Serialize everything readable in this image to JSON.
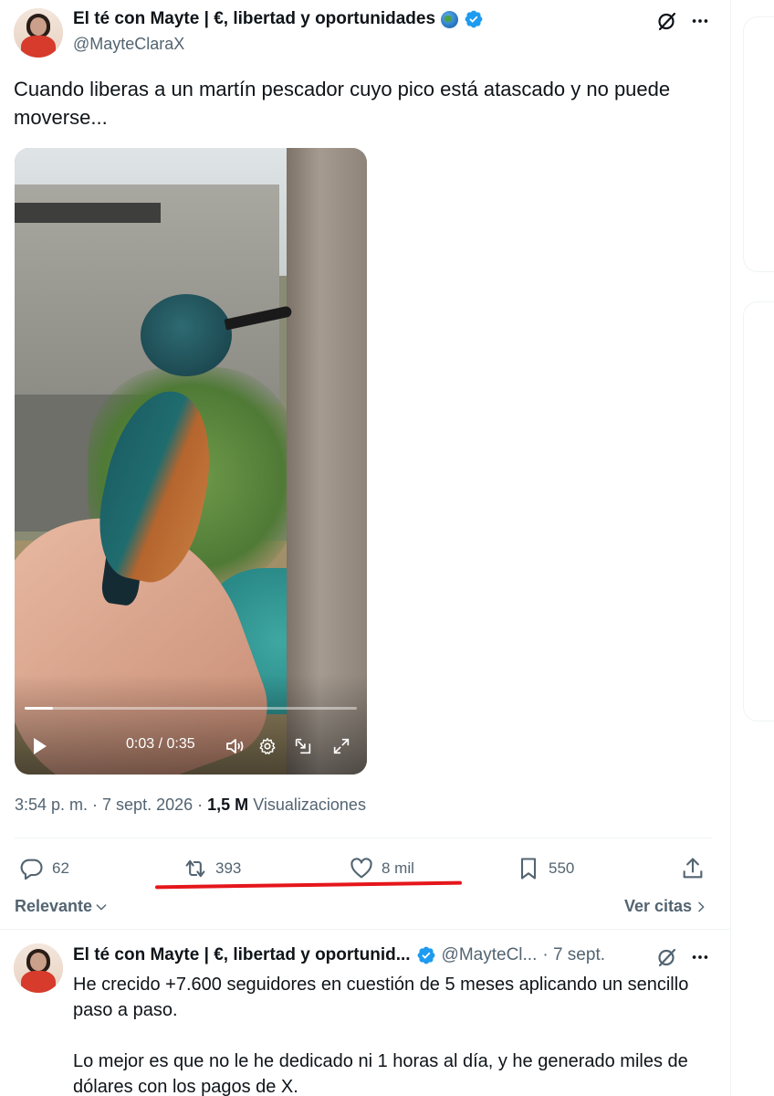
{
  "tweet": {
    "author_name": "El té con Mayte | €, libertad y oportunidades",
    "author_handle": "@MayteClaraX",
    "text": "Cuando liberas a un martín pescador cuyo pico está atascado y no puede moverse...",
    "video": {
      "current_time": "0:03",
      "duration": "0:35",
      "time_label": "0:03 / 0:35",
      "progress_fraction": 0.086
    },
    "timestamp": "3:54 p. m. · 7 sept. 2026",
    "separator": "·",
    "views_count": "1,5 M",
    "views_label": "Visualizaciones",
    "stats": {
      "replies": "62",
      "reposts": "393",
      "likes": "8 mil",
      "bookmarks": "550"
    }
  },
  "replies_section": {
    "sort_label": "Relevante",
    "quotes_link": "Ver citas"
  },
  "reply": {
    "author_name": "El té con Mayte | €, libertad y oportunid...",
    "author_handle": "@MayteCl...",
    "time": "· 7 sept.",
    "paragraphs": [
      "He crecido +7.600 seguidores en cuestión de 5 meses aplicando un sencillo paso a paso.",
      "Lo mejor es que no le he dedicado ni 1 horas al día, y he generado miles de dólares con los pagos de X."
    ]
  },
  "colors": {
    "accent_blue": "#1d9bf0",
    "text_primary": "#0f1419",
    "text_secondary": "#536471",
    "annotation_red": "#e5161b"
  },
  "icons": {
    "verified": "verified-badge-icon",
    "globe": "globe-emoji-icon",
    "grok": "grok-icon",
    "more": "more-icon",
    "reply": "reply-icon",
    "repost": "repost-icon",
    "like": "heart-icon",
    "bookmark": "bookmark-icon",
    "share": "share-icon",
    "play": "play-icon",
    "volume": "volume-icon",
    "settings": "gear-icon",
    "pip": "picture-in-picture-icon",
    "fullscreen": "fullscreen-icon"
  }
}
